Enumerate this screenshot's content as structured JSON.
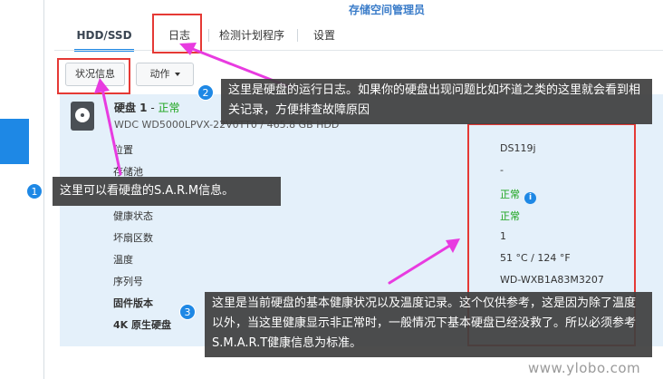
{
  "app": {
    "title": "存储空间管理员"
  },
  "tabs": [
    {
      "label": "HDD/SSD"
    },
    {
      "label": "日志"
    },
    {
      "label": "检测计划程序"
    },
    {
      "label": "设置"
    }
  ],
  "toolbar": {
    "status_info": "状况信息",
    "action": "动作"
  },
  "disk": {
    "name": "硬盘 1",
    "dash": " - ",
    "status": "正常",
    "model": "WDC WD5000LPVX-22V0TT0 / 465.8 GB HDD"
  },
  "rows": [
    {
      "label": "位置",
      "value": "DS119j"
    },
    {
      "label": "存储池",
      "value": "-"
    },
    {
      "label": "健康状态",
      "value": "正常"
    },
    {
      "label": "坏扇区数",
      "value": "1"
    },
    {
      "label": "温度",
      "value": "51 °C / 124 °F"
    },
    {
      "label": "序列号",
      "value": "WD-WXB1A83M3207"
    },
    {
      "label": "固件版本",
      "value": ""
    },
    {
      "label": "4K 原生硬盘",
      "value": ""
    }
  ],
  "rows_extra": {
    "label": "",
    "value": "正常"
  },
  "callouts": [
    {
      "num": "1",
      "text": "这里可以看硬盘的S.A.R.M信息。"
    },
    {
      "num": "2",
      "text": "这里是硬盘的运行日志。如果你的硬盘出现问题比如坏道之类的这里就会看到相关记录，方便排查故障原因"
    },
    {
      "num": "3",
      "text": "这里是当前硬盘的基本健康状况以及温度记录。这个仅供参考，这是因为除了温度以外，当这里健康显示非正常时，一般情况下基本硬盘已经没救了。所以必须参考S.M.A.R.T健康信息为标准。"
    }
  ],
  "watermark": "www.ylobo.com",
  "colors": {
    "accent": "#1e88e5",
    "ok": "#1aa31a",
    "highlight": "#e53935",
    "arrow": "#e83be0"
  }
}
